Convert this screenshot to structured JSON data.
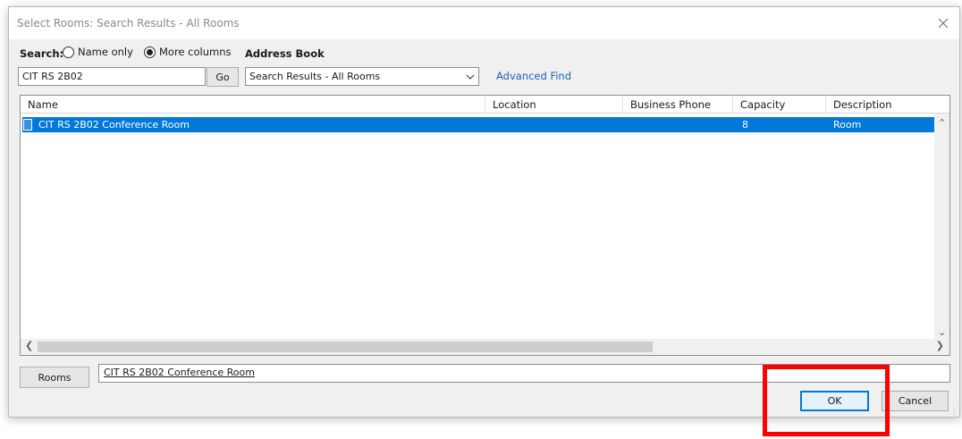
{
  "window": {
    "title": "Select Rooms: Search Results - All Rooms",
    "close_icon": "close-icon"
  },
  "search": {
    "label": "Search:",
    "value": "CIT RS 2B02",
    "options": [
      {
        "label": "Name only",
        "checked": false
      },
      {
        "label": "More columns",
        "checked": true
      }
    ],
    "go_label": "Go"
  },
  "address_book": {
    "label": "Address Book",
    "selected": "Search Results - All Rooms",
    "advanced_find_label": "Advanced Find"
  },
  "table": {
    "columns": [
      "Name",
      "Location",
      "Business Phone",
      "Capacity",
      "Description"
    ],
    "rows": [
      {
        "name": "CIT RS 2B02 Conference Room",
        "location": "",
        "business_phone": "",
        "capacity": "8",
        "description": "Room",
        "selected": true
      }
    ]
  },
  "rooms": {
    "button_label": "Rooms",
    "value": "CIT RS 2B02 Conference Room"
  },
  "actions": {
    "ok_label": "OK",
    "cancel_label": "Cancel"
  },
  "colors": {
    "selection": "#0078d7",
    "link": "#1b62b8",
    "highlight": "#ff0000"
  }
}
